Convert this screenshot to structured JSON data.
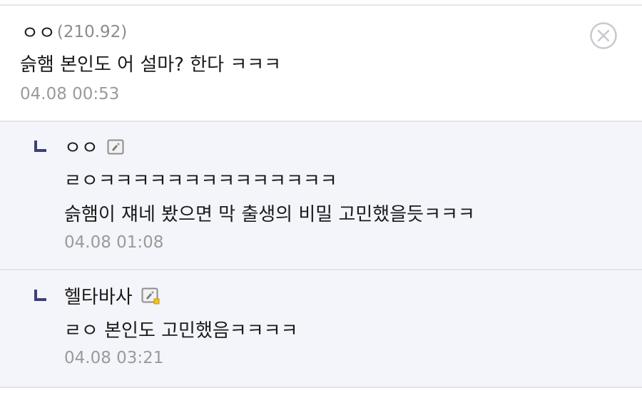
{
  "comments": [
    {
      "nickname": "ㅇㅇ",
      "ip": "(210.92)",
      "text": "슭햄 본인도 어 설마? 한다 ㅋㅋㅋ",
      "date": "04.08 00:53"
    }
  ],
  "replies": [
    {
      "nickname": "ㅇㅇ",
      "lines": [
        "ㄹㅇㅋㅋㅋㅋㅋㅋㅋㅋㅋㅋㅋㅋㅋㅋ",
        "슭햄이 쟤네 봤으면 막 출생의 비밀 고민했을듯ㅋㅋㅋ"
      ],
      "date": "04.08 01:08",
      "badge_icon": "fixed-nick-badge-icon"
    },
    {
      "nickname": "헬타바사",
      "lines": [
        "ㄹㅇ 본인도 고민했음ㅋㅋㅋㅋ"
      ],
      "date": "04.08 03:21",
      "badge_icon": "half-fixed-nick-badge-icon"
    }
  ],
  "colors": {
    "reply_background": "#f4f5fa",
    "reply_mark": "#3b3f7a",
    "date_text": "#9a9a9a",
    "divider": "#e3e4ea"
  }
}
